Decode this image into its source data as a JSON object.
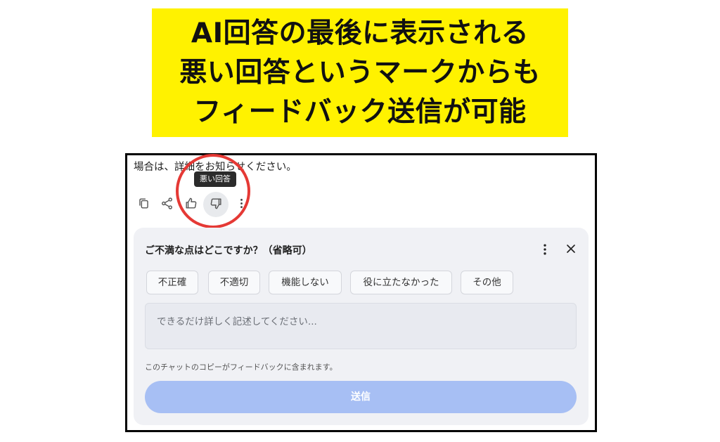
{
  "banner": {
    "lines": [
      "AI回答の最後に表示される",
      "悪い回答というマークからも",
      "フィードバック送信が可能"
    ],
    "background": "#fff200"
  },
  "chat": {
    "intro_text": "場合は、詳細をお知らせください。",
    "tooltip": "悪い回答"
  },
  "actions": {
    "icons": [
      "copy-icon",
      "share-icon",
      "thumbs-up-icon",
      "thumbs-down-icon",
      "more-vertical-icon"
    ]
  },
  "feedback": {
    "title": "ご不満な点はどこですか？（省略可）",
    "chips": [
      "不正確",
      "不適切",
      "機能しない",
      "役に立たなかった",
      "その他"
    ],
    "textarea_placeholder": "できるだけ詳しく記述してください...",
    "note": "このチャットのコピーがフィードバックに含まれます。",
    "submit_label": "送信"
  },
  "colors": {
    "highlight_circle": "#e53935",
    "panel_bg": "#f0f1f5",
    "submit_bg": "#a7bff4"
  }
}
